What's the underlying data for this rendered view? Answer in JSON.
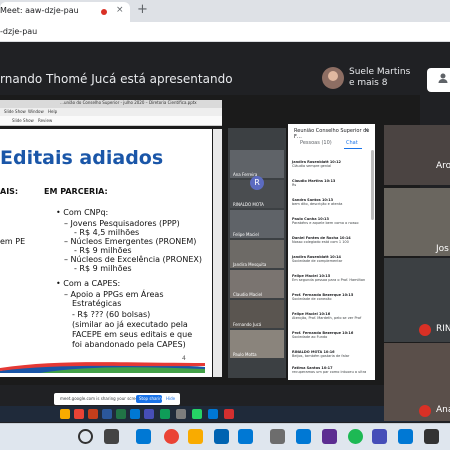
{
  "browser": {
    "tab_title": "Meet: aaw-dzje-pau",
    "tab_close": "×",
    "new_tab": "+",
    "address": "-dzje-pau"
  },
  "meet": {
    "presenting": "rnando Thomé Jucá está apresentando",
    "others_name": "Suele Martins",
    "others_more": "e mais 8",
    "user_icon": "person-add-icon"
  },
  "ppt": {
    "titlebar": "…união do Conselho Superior - julho 2020 – Diretoria Científica.pptx",
    "menu": [
      "Slide Show",
      "Window",
      "Help"
    ],
    "ribbon": [
      "Slide Show",
      "Review"
    ]
  },
  "slide": {
    "title": "Editais adiados",
    "col1_head": "AIS:",
    "col1_line": "em PE",
    "col2_head": "EM PARCERIA:",
    "lines": [
      "• Com CNPq:",
      "– Jovens Pesquisadores (PPP)",
      "- R$ 4,5 milhões",
      "– Núcleos Emergentes (PRONEM)",
      "- R$ 9 milhões",
      "– Núcleos de Excelência (PRONEX)",
      "- R$ 9 milhões",
      "• Com a CAPES:",
      "– Apoio a PPGs em Áreas",
      "Estratégicas",
      "- R$ ??? (60 bolsas)",
      "(similar ao já executado pela",
      "FACEPE em seus editais e que",
      "foi abandonado pela CAPES)"
    ],
    "page_number": "4"
  },
  "share_panel": {
    "tiles": [
      "Ana Ferreira",
      "RINALDO MOTA",
      "Felipe Maciel",
      "Jandira Mesquita",
      "Claudio Maciel",
      "Fernando Jucá",
      "Paulo Motta"
    ],
    "r_letter": "R"
  },
  "chat": {
    "title": "Reunião Conselho Superior de F…",
    "tab_people": "Pessoas (10)",
    "tab_chat": "Chat",
    "messages": [
      {
        "author": "Jandira Rosenblatt 10:12",
        "body": "Cláudio sempre genial"
      },
      {
        "author": "Claudio Martins 10:13",
        "body": "Rs"
      },
      {
        "author": "Sandra Santos 10:13",
        "body": "bem dito, descrição e atenta"
      },
      {
        "author": "Paulo Cunha 10:13",
        "body": "Parabéns e aquele bem como o nosso"
      },
      {
        "author": "Daniel Fontes de Rocha 10:14",
        "body": "Nosso colegiado está com 1 100"
      },
      {
        "author": "Jandira Rosenblatt 10:14",
        "body": "Sociedade de complementar"
      },
      {
        "author": "Felipe Maciel 10:15",
        "body": "Em segunda pessoa para o Prof. Hamilton"
      },
      {
        "author": "Prof. Fernando Bezerque 10:15",
        "body": "Sociedade de conexão"
      },
      {
        "author": "Felipe Maciel 10:16",
        "body": "Atenção, Prof. Mardeth, pelo se ver Prof"
      },
      {
        "author": "Prof. Fernando Bezerque 10:16",
        "body": "Sociedade ao Fundo"
      },
      {
        "author": "RINALDO MOTA 10:16",
        "body": "Beijos, também gostaria de falar"
      },
      {
        "author": "Fatima Santos 10:17",
        "body": "recuperamos um par como intuoeu a ultra"
      }
    ]
  },
  "share_banner": {
    "text": "meet.google.com is sharing your screen",
    "stop": "Stop sharing",
    "hide": "Hide"
  },
  "participants": [
    {
      "name": "Aro",
      "muted": false
    },
    {
      "name": "Jos",
      "muted": false
    },
    {
      "name": "RIN",
      "muted": true
    },
    {
      "name": "Ana",
      "muted": true
    }
  ],
  "colors": {
    "meet_bg": "#202124",
    "slide_title": "#1a56a8",
    "stop_button": "#1a73e8",
    "mute_red": "#d93025"
  }
}
